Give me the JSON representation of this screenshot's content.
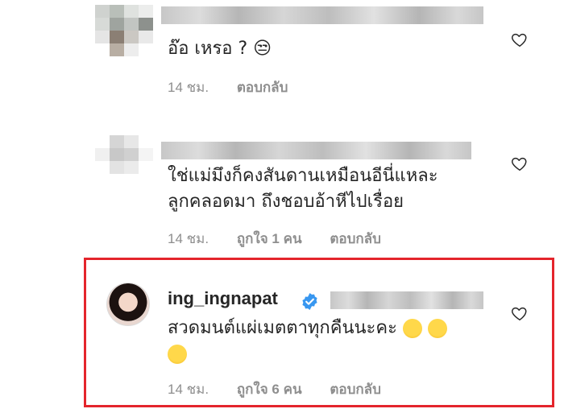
{
  "comments": [
    {
      "text_lines": [
        "อ๊อ เหรอ ? 😒"
      ],
      "time": "14 ชม.",
      "likes": "",
      "reply": "ตอบกลับ"
    },
    {
      "text_lines": [
        "ใช่แม่มึงก็คงสันดานเหมือนอีนี่แหละ",
        "ลูกคลอดมา ถึงชอบอ้าหีไปเรื่อย"
      ],
      "time": "14 ชม.",
      "likes": "ถูกใจ 1 คน",
      "reply": "ตอบกลับ"
    },
    {
      "username": "ing_ingnapat",
      "text_lines": [
        "สวดมนต์แผ่เมตตาทุกคืนนะคะ",
        ""
      ],
      "time": "14 ชม.",
      "likes": "ถูกใจ 6 คน",
      "reply": "ตอบกลับ"
    }
  ],
  "colors": {
    "highlight_border": "#e4252c",
    "meta_text": "#8e8e8e",
    "verified_badge": "#3897f0"
  },
  "icons": [
    "heart-icon",
    "verified-badge-icon",
    "laughing-emoji-icon",
    "unamused-emoji-icon"
  ]
}
